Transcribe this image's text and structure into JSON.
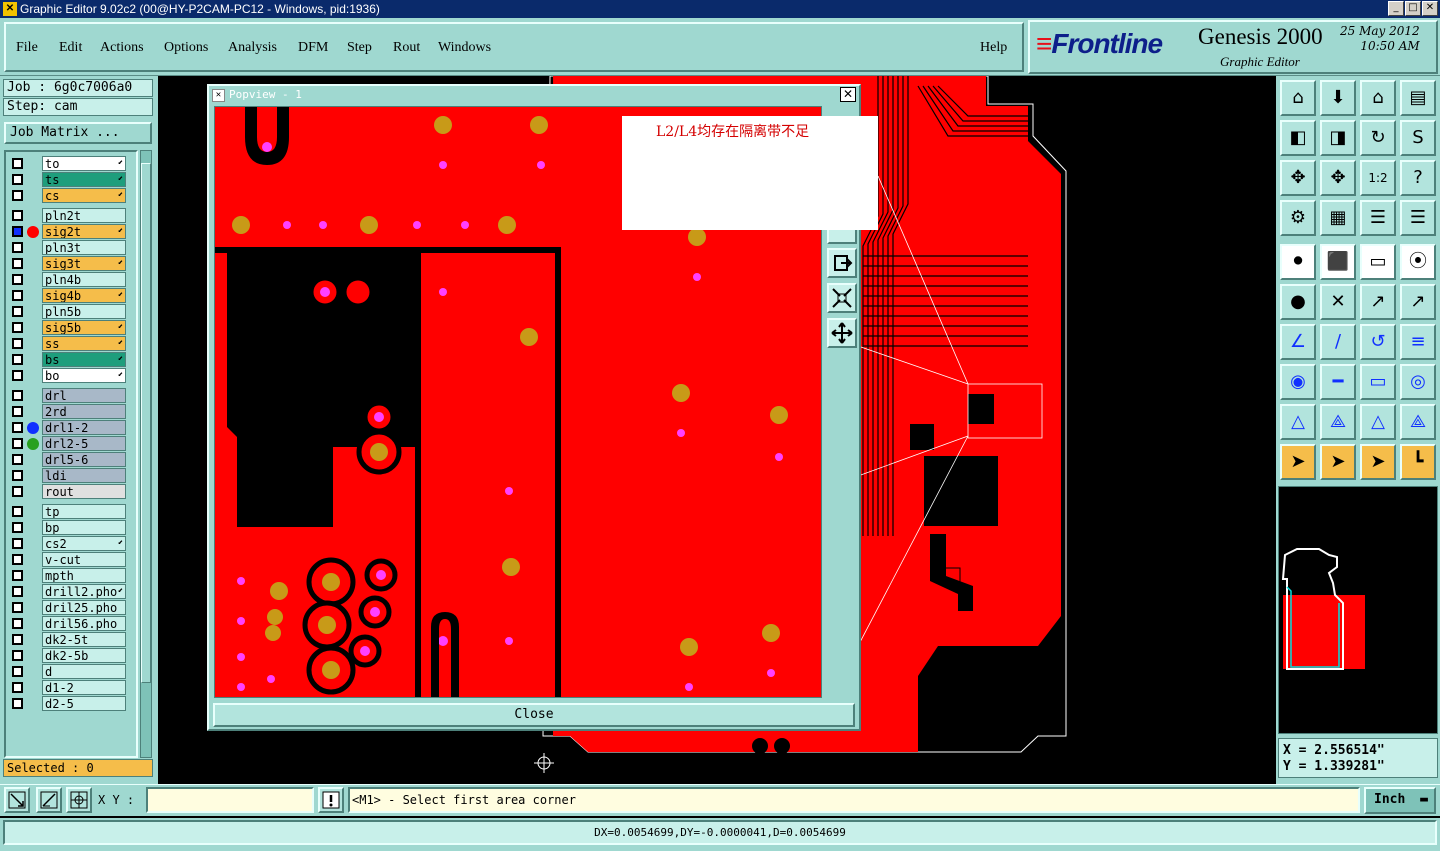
{
  "window": {
    "title": "Graphic Editor 9.02c2 (00@HY-P2CAM-PC12 - Windows, pid:1936)",
    "min": "_",
    "max": "□",
    "close": "✕"
  },
  "menu": {
    "items": [
      "File",
      "Edit",
      "Actions",
      "Options",
      "Analysis",
      "DFM",
      "Step",
      "Rout",
      "Windows"
    ],
    "help": "Help"
  },
  "brand": {
    "logo": "Frontline",
    "product": "Genesis 2000",
    "subtitle": "Graphic Editor",
    "date": "25 May 2012",
    "time": "10:50 AM"
  },
  "left": {
    "job": "Job : 6g0c7006a0",
    "step": "Step: cam",
    "job_matrix": "Job Matrix ...",
    "selected": "Selected : 0",
    "layers": [
      {
        "name": "to",
        "bg": "#ffffff",
        "arrow": true
      },
      {
        "name": "ts",
        "bg": "#1e9e7c",
        "arrow": true
      },
      {
        "name": "cs",
        "bg": "#f5bd4a",
        "arrow": true
      },
      {
        "name": "pln2t",
        "bg": "#c8f0ea",
        "arrow": false
      },
      {
        "name": "sig2t",
        "bg": "#f5bd4a",
        "arrow": true,
        "dot": "#ff0000",
        "active": true
      },
      {
        "name": "pln3t",
        "bg": "#c8f0ea",
        "arrow": false
      },
      {
        "name": "sig3t",
        "bg": "#f5bd4a",
        "arrow": true
      },
      {
        "name": "pln4b",
        "bg": "#c8f0ea",
        "arrow": false
      },
      {
        "name": "sig4b",
        "bg": "#f5bd4a",
        "arrow": true
      },
      {
        "name": "pln5b",
        "bg": "#c8f0ea",
        "arrow": false
      },
      {
        "name": "sig5b",
        "bg": "#f5bd4a",
        "arrow": true
      },
      {
        "name": "ss",
        "bg": "#f5bd4a",
        "arrow": true
      },
      {
        "name": "bs",
        "bg": "#1e9e7c",
        "arrow": true
      },
      {
        "name": "bo",
        "bg": "#ffffff",
        "arrow": true
      },
      {
        "name": "drl",
        "bg": "#a8b8c8",
        "arrow": false
      },
      {
        "name": "2rd",
        "bg": "#a8b8c8",
        "arrow": false
      },
      {
        "name": "drl1-2",
        "bg": "#a8b8c8",
        "arrow": false,
        "dot": "#1030ff"
      },
      {
        "name": "drl2-5",
        "bg": "#a8b8c8",
        "arrow": false,
        "dot": "#28a020"
      },
      {
        "name": "drl5-6",
        "bg": "#a8b8c8",
        "arrow": false
      },
      {
        "name": "ldi",
        "bg": "#a8b8c8",
        "arrow": false
      },
      {
        "name": "rout",
        "bg": "#e0e0e0",
        "arrow": false
      },
      {
        "name": "tp",
        "bg": "#c8f0ea",
        "arrow": false
      },
      {
        "name": "bp",
        "bg": "#c8f0ea",
        "arrow": false
      },
      {
        "name": "cs2",
        "bg": "#c8f0ea",
        "arrow": true
      },
      {
        "name": "v-cut",
        "bg": "#c8f0ea",
        "arrow": false
      },
      {
        "name": "mpth",
        "bg": "#c8f0ea",
        "arrow": false
      },
      {
        "name": "drill2.pho",
        "bg": "#c8f0ea",
        "arrow": true
      },
      {
        "name": "dril25.pho",
        "bg": "#c8f0ea",
        "arrow": false
      },
      {
        "name": "dril56.pho",
        "bg": "#c8f0ea",
        "arrow": false
      },
      {
        "name": "dk2-5t",
        "bg": "#c8f0ea",
        "arrow": false
      },
      {
        "name": "dk2-5b",
        "bg": "#c8f0ea",
        "arrow": false
      },
      {
        "name": "d",
        "bg": "#c8f0ea",
        "arrow": false
      },
      {
        "name": "d1-2",
        "bg": "#c8f0ea",
        "arrow": false
      },
      {
        "name": "d2-5",
        "bg": "#c8f0ea",
        "arrow": false
      }
    ]
  },
  "popview": {
    "title": "Popview - 1",
    "close_label": "Close",
    "annotation": "L2/L4均存在隔离带不足"
  },
  "right": {
    "x_coord": "X = 2.556514\"",
    "y_coord": "Y = 1.339281\""
  },
  "bottom": {
    "xy_label": "X Y :",
    "xy_value": "",
    "prompt": "<M1> - Select first area corner",
    "unit": "Inch",
    "status": "DX=0.0054699,DY=-0.0000041,D=0.0054699"
  }
}
